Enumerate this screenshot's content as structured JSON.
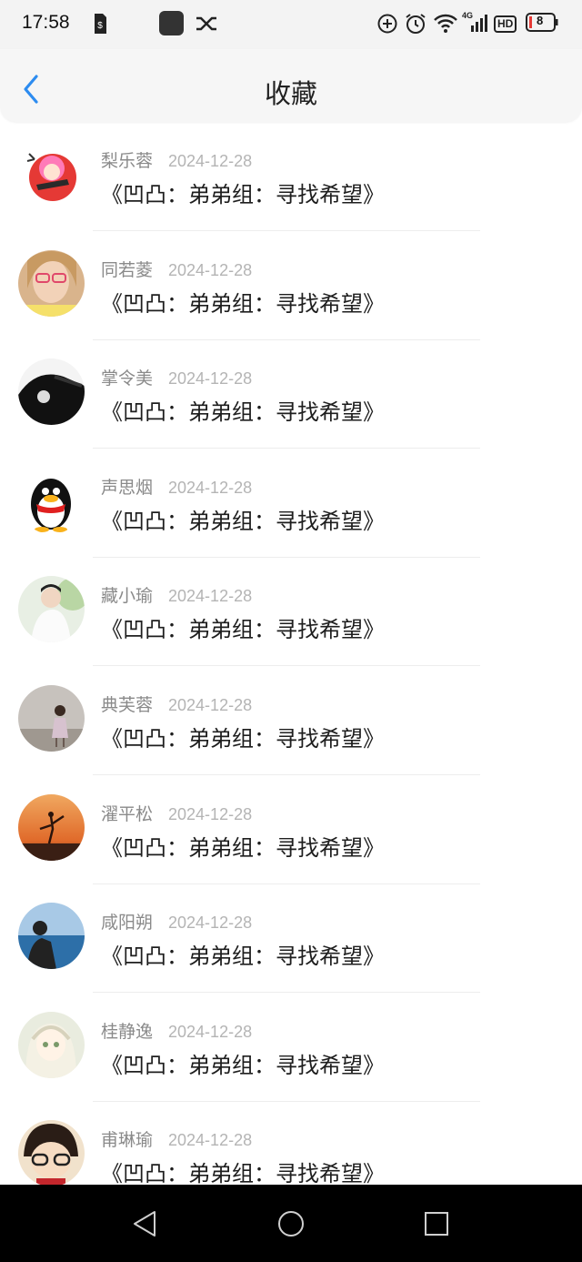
{
  "status_bar": {
    "time": "17:58",
    "network_label": "4G",
    "hd_label": "HD",
    "battery_level": "8",
    "icons": [
      "sim-icon",
      "app-icon",
      "shuffle-icon",
      "add-circle-icon",
      "alarm-icon",
      "wifi-icon",
      "signal-icon",
      "hd-icon",
      "battery-icon"
    ]
  },
  "header": {
    "title": "收藏",
    "back_icon": "chevron-left-icon",
    "accent_color": "#2d8cf0"
  },
  "items": [
    {
      "name": "梨乐蓉",
      "date": "2024-12-28",
      "title": "《凹凸：弟弟组：寻找希望》"
    },
    {
      "name": "同若菱",
      "date": "2024-12-28",
      "title": "《凹凸：弟弟组：寻找希望》"
    },
    {
      "name": "掌令美",
      "date": "2024-12-28",
      "title": "《凹凸：弟弟组：寻找希望》"
    },
    {
      "name": "声思烟",
      "date": "2024-12-28",
      "title": "《凹凸：弟弟组：寻找希望》"
    },
    {
      "name": "藏小瑜",
      "date": "2024-12-28",
      "title": "《凹凸：弟弟组：寻找希望》"
    },
    {
      "name": "典芙蓉",
      "date": "2024-12-28",
      "title": "《凹凸：弟弟组：寻找希望》"
    },
    {
      "name": "濯平松",
      "date": "2024-12-28",
      "title": "《凹凸：弟弟组：寻找希望》"
    },
    {
      "name": "咸阳朔",
      "date": "2024-12-28",
      "title": "《凹凸：弟弟组：寻找希望》"
    },
    {
      "name": "桂静逸",
      "date": "2024-12-28",
      "title": "《凹凸：弟弟组：寻找希望》"
    },
    {
      "name": "甫琳瑜",
      "date": "2024-12-28",
      "title": "《凹凸：弟弟组：寻找希望》"
    }
  ],
  "nav_bar": {
    "icons": [
      "back-triangle-icon",
      "home-circle-icon",
      "recents-square-icon"
    ]
  }
}
